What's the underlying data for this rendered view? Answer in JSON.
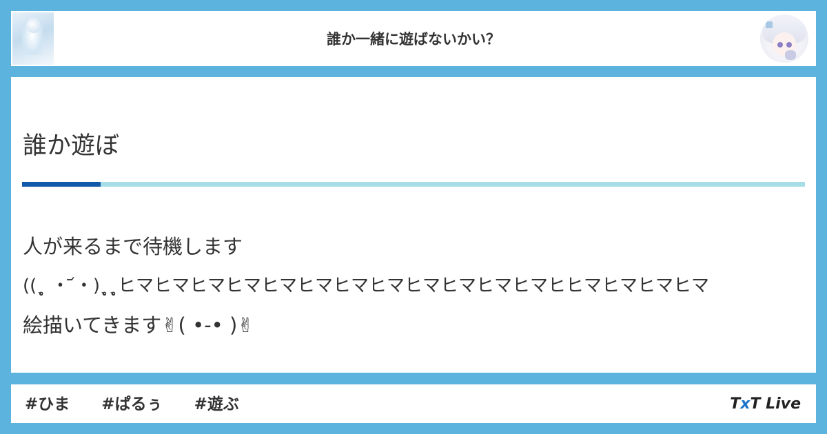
{
  "header": {
    "title": "誰か一緒に遊ばないかい？",
    "left_image": "room-thumbnail-illustration",
    "avatar": "user-avatar-illustration"
  },
  "post": {
    "title": "誰か遊ぼ",
    "lines": [
      "人が来るまで待機します",
      "((ˎ̥ ・ ᷄・)ˎ̥ˎ̥ヒマヒマヒマヒマヒマヒマヒマヒマヒマヒマヒマヒマヒヒマヒマヒマヒマ",
      "絵描いてきます✌︎(     •-•     )✌︎"
    ]
  },
  "footer": {
    "tags": [
      "#ひま",
      "#ぱるぅ",
      "#遊ぶ"
    ],
    "brand": {
      "part1": "T",
      "part2": "x",
      "part3": "T Live"
    }
  },
  "colors": {
    "background": "#5cb3dd",
    "accent": "#1158a8",
    "rule": "#a6dde6",
    "brand_x": "#1b74c9"
  }
}
